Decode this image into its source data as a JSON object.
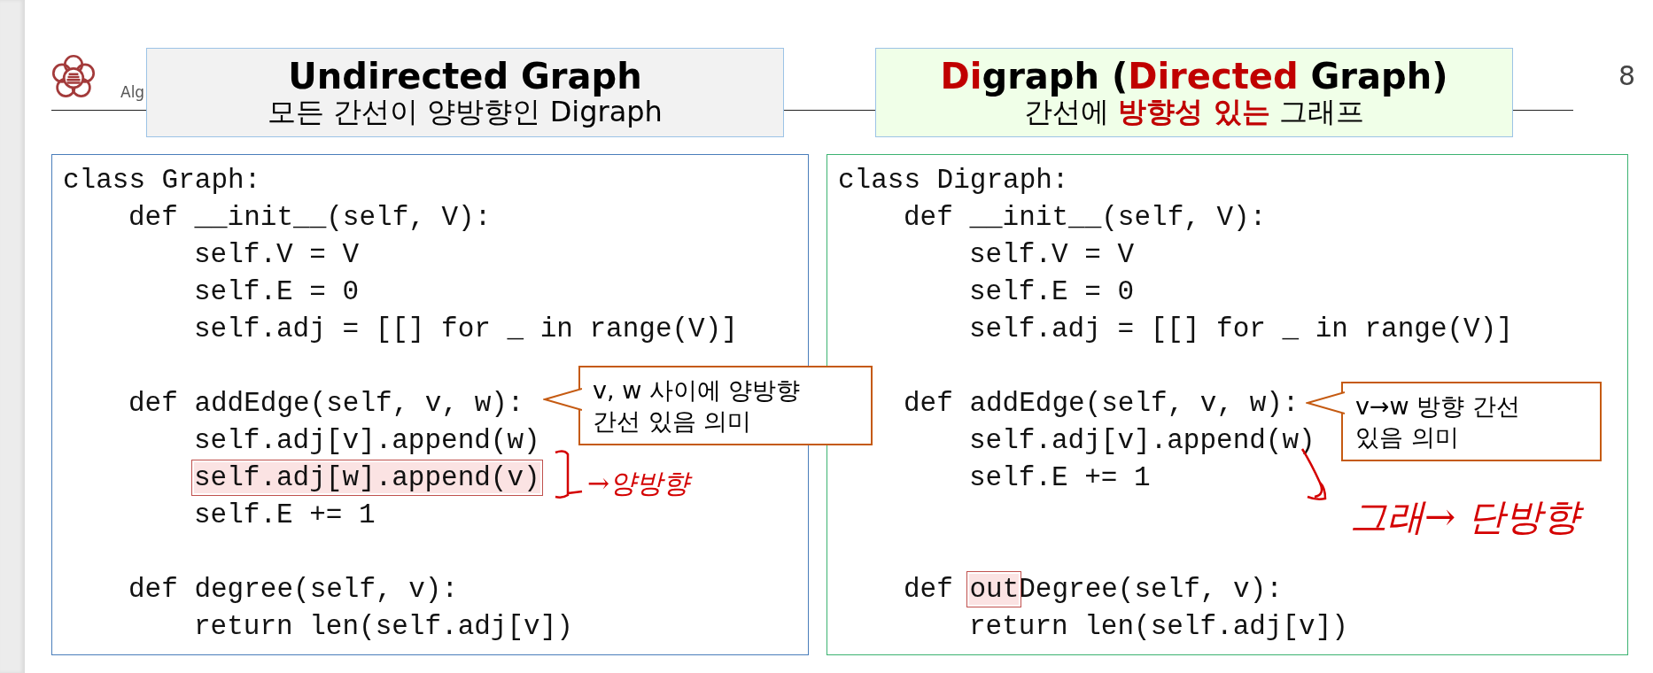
{
  "header": {
    "course_label": "Alg",
    "page_number": "8"
  },
  "panels": [
    {
      "title": [
        {
          "text": "Undirected Graph",
          "accent": false
        }
      ],
      "subtitle": [
        {
          "text": "모든 간선이 양방향인 Digraph",
          "accent": false
        }
      ],
      "code": [
        {
          "kind": "top",
          "segments": [
            {
              "text": "class Graph:",
              "highlighted": false
            }
          ]
        },
        {
          "kind": "method",
          "segments": [
            {
              "text": "def __init__(self, V):",
              "highlighted": false
            }
          ]
        },
        {
          "kind": "body",
          "segments": [
            {
              "text": "self.V = V",
              "highlighted": false
            }
          ]
        },
        {
          "kind": "body",
          "segments": [
            {
              "text": "self.E = 0",
              "highlighted": false
            }
          ]
        },
        {
          "kind": "body",
          "segments": [
            {
              "text": "self.adj = [[] for _ in range(V)]",
              "highlighted": false
            }
          ]
        },
        {
          "kind": "blank"
        },
        {
          "kind": "method",
          "segments": [
            {
              "text": "def addEdge(self, v, w):",
              "highlighted": false
            }
          ]
        },
        {
          "kind": "body",
          "segments": [
            {
              "text": "self.adj[v].append(w)",
              "highlighted": false
            }
          ]
        },
        {
          "kind": "body",
          "segments": [
            {
              "text": "self.adj[w].append(v)",
              "highlighted": true
            }
          ]
        },
        {
          "kind": "body",
          "segments": [
            {
              "text": "self.E += 1",
              "highlighted": false
            }
          ]
        },
        {
          "kind": "blank"
        },
        {
          "kind": "method",
          "segments": [
            {
              "text": "def degree(self, v):",
              "highlighted": false
            }
          ]
        },
        {
          "kind": "body",
          "segments": [
            {
              "text": "return len(self.adj[v])",
              "highlighted": false
            }
          ]
        }
      ],
      "callout": {
        "lines": [
          "v, w 사이에 양방향",
          "간선 있음 의미"
        ]
      },
      "handwritten_note": "→양방향"
    },
    {
      "title": [
        {
          "text": "Di",
          "accent": true
        },
        {
          "text": "graph (",
          "accent": false
        },
        {
          "text": "Directed",
          "accent": true
        },
        {
          "text": " Graph)",
          "accent": false
        }
      ],
      "subtitle": [
        {
          "text": "간선에 ",
          "accent": false
        },
        {
          "text": "방향성 있는",
          "accent": true
        },
        {
          "text": " 그래프",
          "accent": false
        }
      ],
      "code": [
        {
          "kind": "top",
          "segments": [
            {
              "text": "class Digraph:",
              "highlighted": false
            }
          ]
        },
        {
          "kind": "method",
          "segments": [
            {
              "text": "def __init__(self, V):",
              "highlighted": false
            }
          ]
        },
        {
          "kind": "body",
          "segments": [
            {
              "text": "self.V = V",
              "highlighted": false
            }
          ]
        },
        {
          "kind": "body",
          "segments": [
            {
              "text": "self.E = 0",
              "highlighted": false
            }
          ]
        },
        {
          "kind": "body",
          "segments": [
            {
              "text": "self.adj = [[] for _ in range(V)]",
              "highlighted": false
            }
          ]
        },
        {
          "kind": "blank"
        },
        {
          "kind": "method",
          "segments": [
            {
              "text": "def addEdge(self, v, w):",
              "highlighted": false
            }
          ]
        },
        {
          "kind": "body",
          "segments": [
            {
              "text": "self.adj[v].append(w)",
              "highlighted": false
            }
          ]
        },
        {
          "kind": "body",
          "segments": [
            {
              "text": "self.E += 1",
              "highlighted": false
            }
          ]
        },
        {
          "kind": "blank"
        },
        {
          "kind": "blank"
        },
        {
          "kind": "method",
          "segments": [
            {
              "text": "def ",
              "highlighted": false
            },
            {
              "text": "out",
              "highlighted": true
            },
            {
              "text": "Degree(self, v):",
              "highlighted": false
            }
          ]
        },
        {
          "kind": "body",
          "segments": [
            {
              "text": "return len(self.adj[v])",
              "highlighted": false
            }
          ]
        }
      ],
      "callout": {
        "lines": [
          "v→w 방향 간선",
          "있음 의미"
        ]
      },
      "handwritten_note": "그래→ 단방향"
    }
  ]
}
